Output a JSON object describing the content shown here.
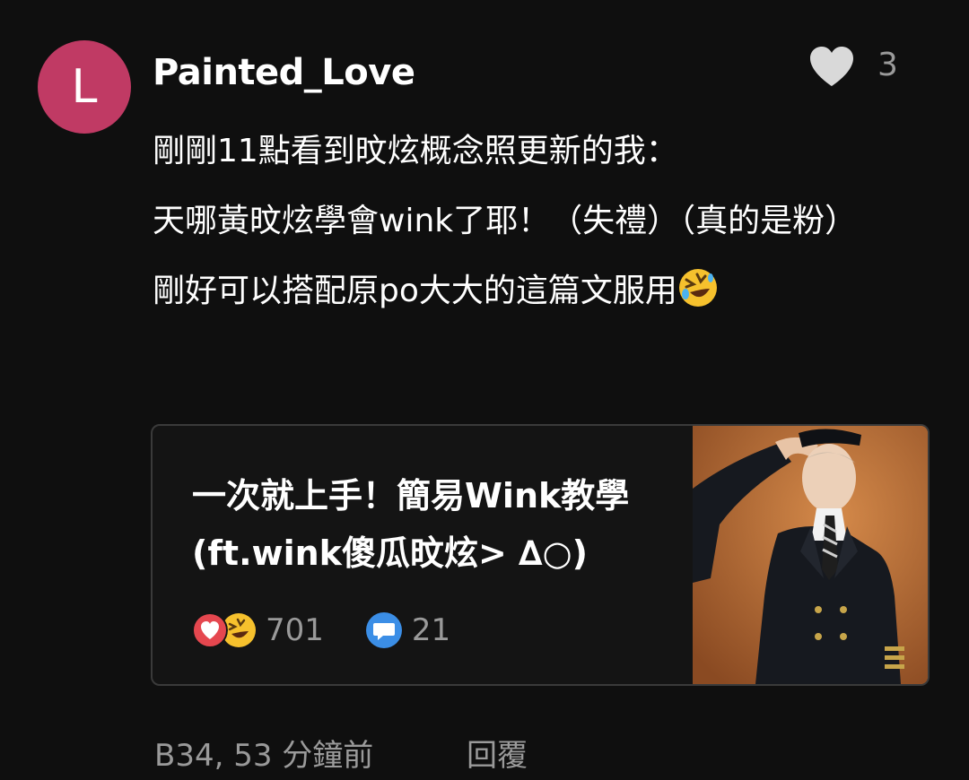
{
  "comment": {
    "avatar_initial": "L",
    "author": "Painted_Love",
    "like_count": "3",
    "lines": [
      "剛剛11點看到旼炫概念照更新的我：",
      "天哪黃旼炫學會wink了耶！（失禮）（真的是粉）",
      "剛好可以搭配原po大大的這篇文服用"
    ],
    "floor_time": "B34, 53 分鐘前",
    "reply_label": "回覆"
  },
  "linked_post": {
    "title": "一次就上手！簡易Wink教學(ft.wink傻瓜旼炫> ∆○)",
    "reaction_count": "701",
    "comment_count": "21",
    "reaction_icons": [
      "heart-reaction-icon",
      "laugh-reaction-icon"
    ],
    "thumbnail_icon": "saluting-pilot-photo"
  },
  "colors": {
    "background": "#0f0f0f",
    "avatar": "#c03a64",
    "muted_text": "#9a9a9a",
    "card_border": "#3a3a3a",
    "heart_reaction": "#e5474f",
    "comment_bubble": "#3b8ee6"
  }
}
